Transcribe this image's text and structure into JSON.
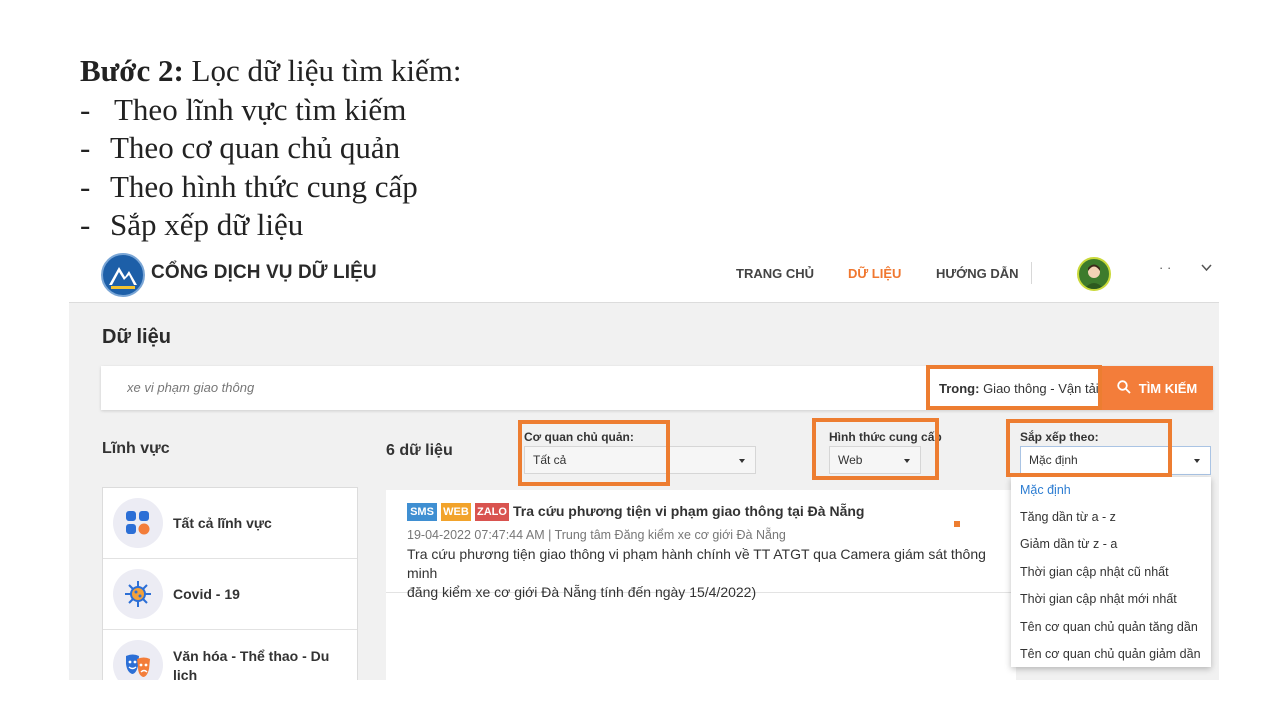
{
  "slide": {
    "step_bold": "Bước 2:",
    "step_text": " Lọc dữ liệu tìm kiếm:",
    "bullets": [
      "Theo lĩnh vực tìm kiếm",
      "Theo cơ quan chủ quản",
      "Theo hình thức cung cấp",
      "Sắp xếp dữ liệu"
    ]
  },
  "header": {
    "site_title": "CỔNG DỊCH VỤ DỮ LIỆU",
    "nav": [
      "TRANG CHỦ",
      "DỮ LIỆU",
      "HƯỚNG DẪN"
    ],
    "active_nav": "DỮ LIỆU",
    "user_name": "· ·"
  },
  "page": {
    "title": "Dữ liệu"
  },
  "search": {
    "placeholder": "xe vi phạm giao thông",
    "scope_label": "Trong:",
    "scope_value": "Giao thông - Vận tải",
    "button_label": "TÌM KIẾM"
  },
  "sidebar": {
    "title": "Lĩnh vực",
    "items": [
      {
        "label": "Tất cả lĩnh vực",
        "icon": "grid-icon"
      },
      {
        "label": "Covid - 19",
        "icon": "virus-icon"
      },
      {
        "label": "Văn hóa - Thể thao - Du lịch",
        "icon": "theater-masks-icon"
      }
    ]
  },
  "results": {
    "count_label": "6 dữ liệu",
    "items": [
      {
        "badges": [
          "SMS",
          "WEB",
          "ZALO"
        ],
        "title": "Tra cứu phương tiện vi phạm giao thông tại Đà Nẵng",
        "meta": "19-04-2022 07:47:44 AM | Trung tâm Đăng kiểm xe cơ giới Đà Nẵng",
        "description": "Tra cứu phương tiện giao thông vi phạm hành chính về TT ATGT qua Camera giám sát thông minh\nđăng kiểm xe cơ giới Đà Nẵng tính đến ngày 15/4/2022)"
      }
    ]
  },
  "filters": {
    "agency": {
      "label": "Cơ quan chủ quản:",
      "value": "Tất cả"
    },
    "provision": {
      "label": "Hình thức cung cấp",
      "value": "Web"
    },
    "sort": {
      "label": "Sắp xếp theo:",
      "value": "Mặc định",
      "options": [
        "Mặc định",
        "Tăng dần từ a - z",
        "Giảm dần từ z - a",
        "Thời gian cập nhật cũ nhất",
        "Thời gian cập nhật mới nhất",
        "Tên cơ quan chủ quản tăng dần",
        "Tên cơ quan chủ quản giảm dần"
      ]
    }
  },
  "colors": {
    "accent": "#f37d3a",
    "highlight": "#ed7d31",
    "link": "#2d7dd2",
    "badge_sms": "#3f8fd2",
    "badge_web": "#f2a32b",
    "badge_zalo": "#d9534f"
  }
}
